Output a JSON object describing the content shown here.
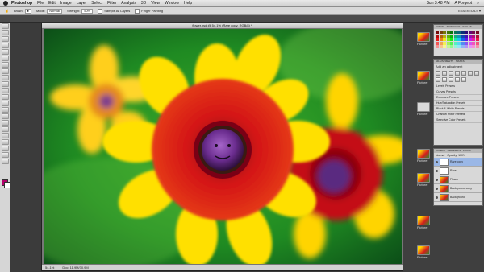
{
  "menubar": {
    "app": "Photoshop",
    "items": [
      "File",
      "Edit",
      "Image",
      "Layer",
      "Select",
      "Filter",
      "Analysis",
      "3D",
      "View",
      "Window",
      "Help"
    ],
    "clock": "Sun 3:48 PM",
    "user": "A Forgeot"
  },
  "options": {
    "brush_label": "Brush:",
    "mode_label": "Mode:",
    "mode_value": "Normal",
    "strength_label": "Strength:",
    "strength_value": "50%",
    "sample_all": "Sample All Layers",
    "finger": "Finger Painting",
    "workspace": "ESSENTIALS ▾"
  },
  "document": {
    "title": "flower.psd @ 54.1% (Rare copy, RGB/8) *",
    "zoom": "54.1%",
    "doc_size": "Doc: 11.9M/30.9M"
  },
  "panels": {
    "color_tabs": [
      "COLOR",
      "SWATCHES",
      "STYLES"
    ],
    "adjust_tabs": [
      "ADJUSTMENTS",
      "MASKS"
    ],
    "adjust_title": "Add an adjustment",
    "presets": [
      "Levels Presets",
      "Curves Presets",
      "Exposure Presets",
      "Hue/Saturation Presets",
      "Black & White Presets",
      "Channel Mixer Presets",
      "Selective Color Presets"
    ],
    "layer_tabs": [
      "LAYERS",
      "CHANNELS",
      "PATHS"
    ],
    "blend_mode": "Normal",
    "opacity": "Opacity: 100%",
    "layers": [
      {
        "name": "Rare copy",
        "selected": true,
        "white": true
      },
      {
        "name": "Rare",
        "selected": false,
        "white": true
      },
      {
        "name": "Flower",
        "selected": false,
        "white": false
      },
      {
        "name": "Background copy",
        "selected": false,
        "white": false
      },
      {
        "name": "Background",
        "selected": false,
        "white": false
      }
    ]
  },
  "thumbnails": [
    "Picture",
    "Picture",
    "Picture",
    "Picture",
    "Picture",
    "Picture",
    "Picture"
  ],
  "colors": {
    "foreground": "#b3006b",
    "background": "#ffffff"
  }
}
